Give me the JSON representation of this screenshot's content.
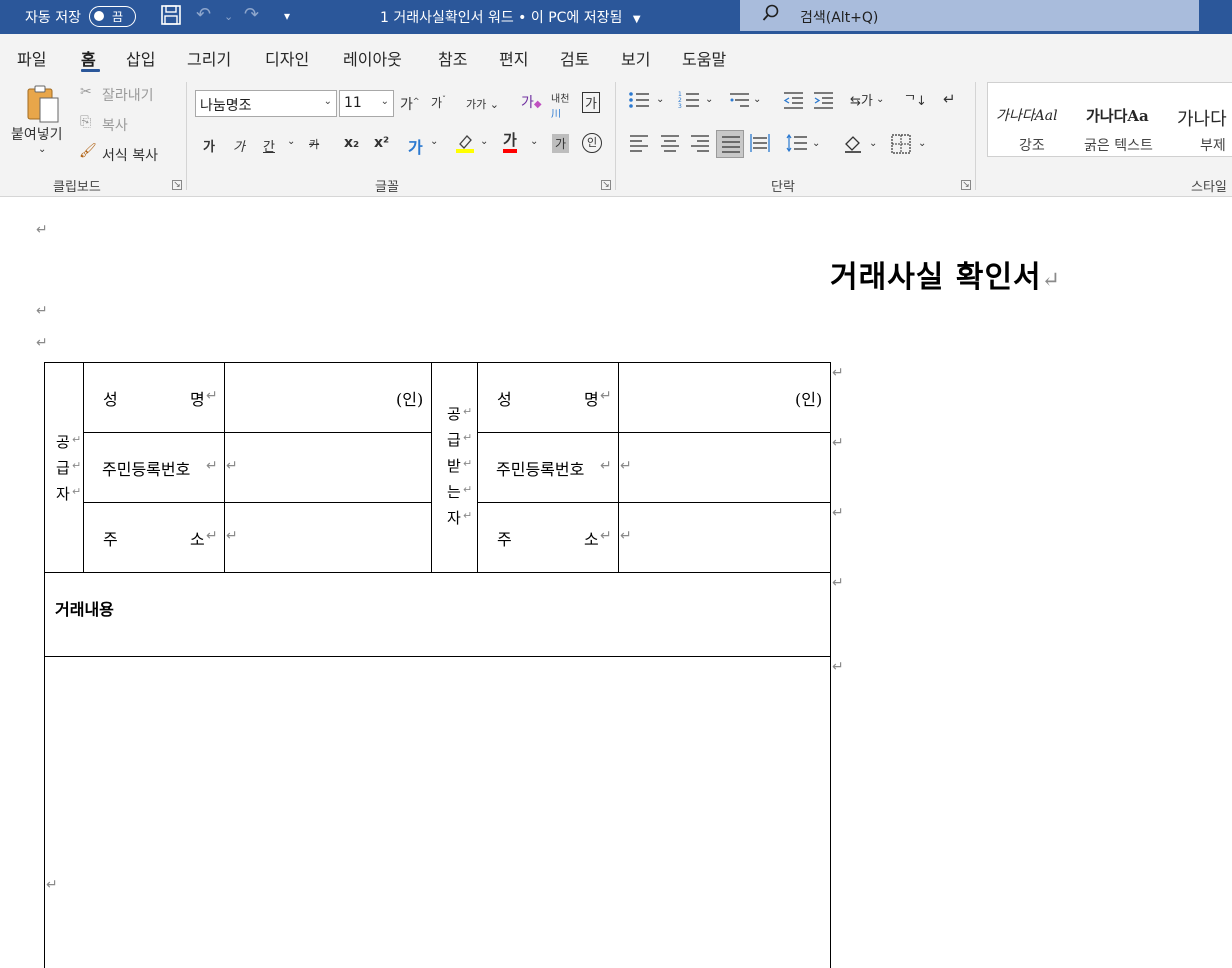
{
  "titlebar": {
    "autosave_label": "자동 저장",
    "autosave_state": "끔",
    "document_title": "1 거래사실확인서 워드 • 이 PC에 저장됨",
    "search_placeholder": "검색(Alt+Q)"
  },
  "tabs": [
    "파일",
    "홈",
    "삽입",
    "그리기",
    "디자인",
    "레이아웃",
    "참조",
    "편지",
    "검토",
    "보기",
    "도움말"
  ],
  "active_tab": "홈",
  "clipboard": {
    "paste": "붙여넣기",
    "cut": "잘라내기",
    "copy": "복사",
    "format_painter": "서식 복사",
    "group_label": "클립보드"
  },
  "font": {
    "name": "나눔명조",
    "size": "11",
    "group_label": "글꼴",
    "grow": "가",
    "shrink": "가",
    "case": "가가",
    "bold": "가",
    "italic": "가",
    "underline": "간",
    "strike": "카",
    "subscript": "x₂",
    "superscript": "x²",
    "effects": "가",
    "font_color": "가",
    "shading": "가",
    "enclosed": "인",
    "clear_format": "가",
    "phonetic_top": "내천",
    "char_border": "가"
  },
  "paragraph": {
    "group_label": "단락"
  },
  "styles": {
    "items": [
      {
        "sample": "가나다Aal",
        "name": "강조"
      },
      {
        "sample": "가나다Aa",
        "name": "굵은 텍스트"
      },
      {
        "sample": "가나다",
        "name": "부제"
      }
    ],
    "group_label": "스타일"
  },
  "document": {
    "heading": "거래사실 확인서",
    "supplier_label": "공급자",
    "receiver_label": "공급받는자",
    "name_label_a": "성",
    "name_label_b": "명",
    "rrn_label": "주민등록번호",
    "address_label_a": "주",
    "address_label_b": "소",
    "seal": "(인)",
    "transaction_label": "거래내용"
  },
  "colors": {
    "titlebar": "#2b579a",
    "ribbon": "#f3f3f3",
    "highlight": "#ffff00",
    "font_color": "#ff0000"
  }
}
